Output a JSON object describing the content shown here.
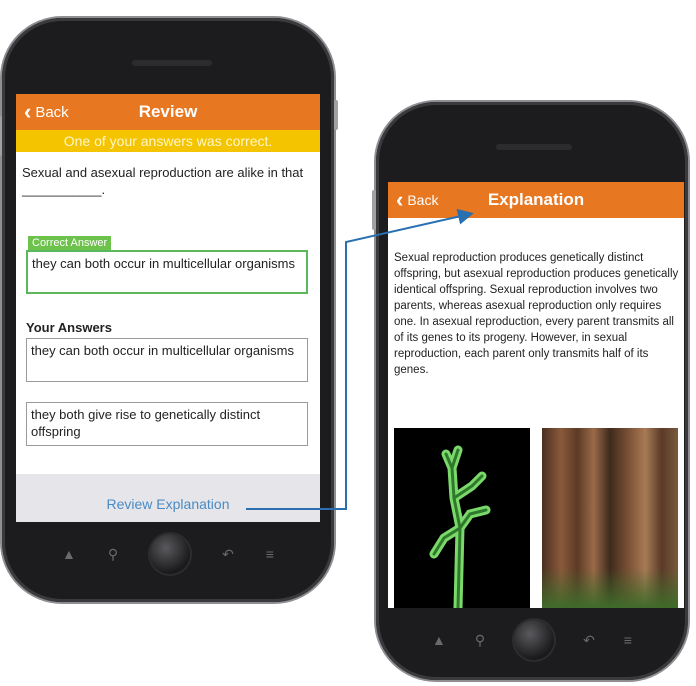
{
  "left_phone": {
    "header": {
      "back_label": "Back",
      "title": "Review"
    },
    "banner": "One of your answers was correct.",
    "question": "Sexual and asexual reproduction are alike in that ___________.",
    "correct_tag": "Correct Answer",
    "correct_answer": "they can both occur in multicellular organisms",
    "your_answers_label": "Your Answers",
    "your_answers": [
      "they can both occur in multicellular organisms",
      "they both give rise to genetically distinct offspring"
    ],
    "review_link": "Review Explanation"
  },
  "right_phone": {
    "header": {
      "back_label": "Back",
      "title": "Explanation"
    },
    "explanation": "Sexual reproduction produces genetically distinct offspring, but asexual reproduction produces genetically identical offspring. Sexual reproduction involves two parents, whereas asexual reproduction only requires one. In asexual reproduction, every parent transmits all of its genes to its progeny. However, in sexual reproduction, each parent only transmits half of its genes.",
    "images": [
      "hydra-photo",
      "redwood-trees-photo"
    ]
  },
  "colors": {
    "header": "#e87722",
    "banner": "#f4c400",
    "correct": "#5cb85c",
    "link": "#4a8ac4",
    "connector": "#2a6fb0"
  },
  "nav_icons": [
    "home-icon",
    "search-icon",
    "home-button",
    "back-icon",
    "menu-icon"
  ]
}
